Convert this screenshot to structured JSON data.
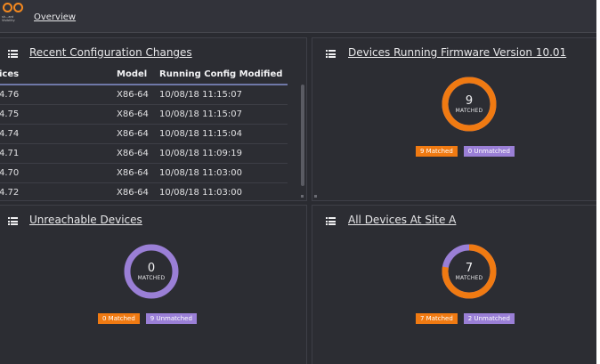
{
  "header": {
    "logo_text": "sh...ard\nVisibility",
    "breadcrumb": "Overview"
  },
  "panels": {
    "recent": {
      "title": "Recent Configuration Changes",
      "columns": [
        "ices",
        "Model",
        "Running Config Modified"
      ],
      "rows": [
        [
          "4.76",
          "X86-64",
          "10/08/18 11:15:07"
        ],
        [
          "4.75",
          "X86-64",
          "10/08/18 11:15:07"
        ],
        [
          "4.74",
          "X86-64",
          "10/08/18 11:15:04"
        ],
        [
          "4.71",
          "X86-64",
          "10/08/18 11:09:19"
        ],
        [
          "4.70",
          "X86-64",
          "10/08/18 11:03:00"
        ],
        [
          "4.72",
          "X86-64",
          "10/08/18 11:03:00"
        ]
      ]
    },
    "firmware": {
      "title": "Devices Running Firmware Version 10.01",
      "count": "9",
      "count_label": "MATCHED",
      "matched": 9,
      "unmatched": 0,
      "matched_label": "9 Matched",
      "unmatched_label": "0 Unmatched"
    },
    "unreachable": {
      "title": "Unreachable Devices",
      "count": "0",
      "count_label": "MATCHED",
      "matched": 0,
      "unmatched": 9,
      "matched_label": "0 Matched",
      "unmatched_label": "9 Unmatched"
    },
    "site_a": {
      "title": "All Devices At Site A",
      "count": "7",
      "count_label": "MATCHED",
      "matched": 7,
      "unmatched": 2,
      "matched_label": "7 Matched",
      "unmatched_label": "2 Unmatched"
    }
  },
  "colors": {
    "matched": "#f07a12",
    "unmatched": "#9a7fd6",
    "background": "#2a2b31"
  },
  "icons": [
    "list-icon"
  ]
}
